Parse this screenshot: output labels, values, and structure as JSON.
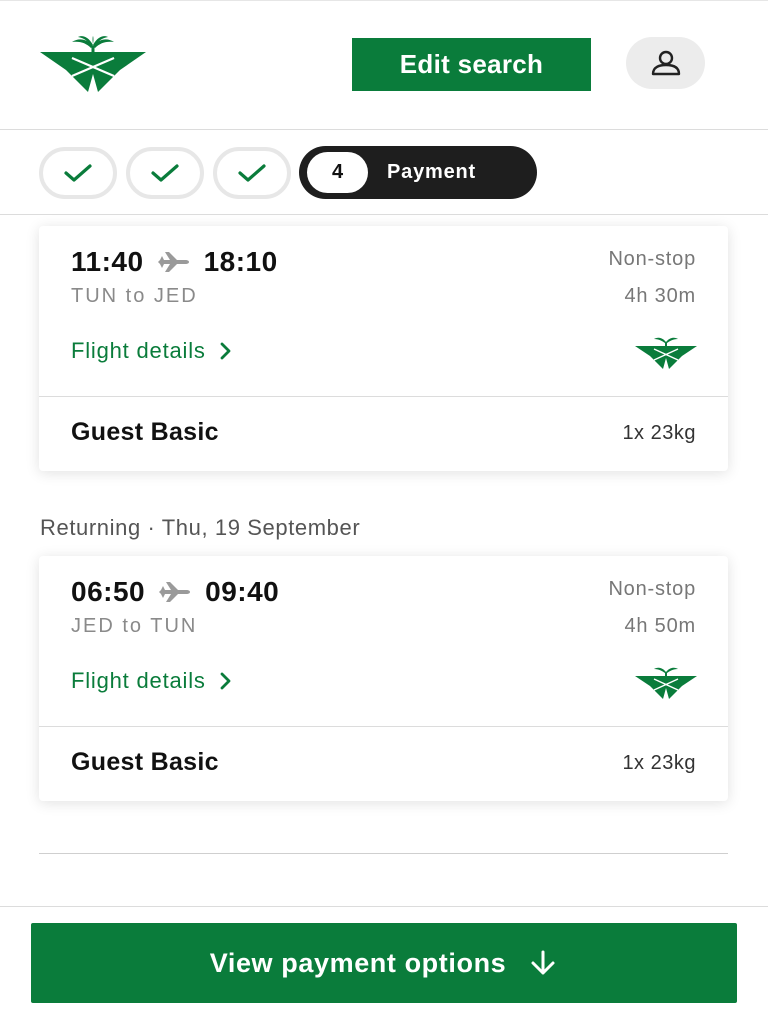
{
  "header": {
    "logo_icon": "saudia-palm-logo-icon",
    "edit_search_label": "Edit search",
    "profile_icon": "user-icon"
  },
  "steps": {
    "completed_count": 3,
    "current_number": "4",
    "current_label": "Payment"
  },
  "flights": [
    {
      "depart_time": "11:40",
      "arrive_time": "18:10",
      "route_from": "TUN",
      "route_sep": "to",
      "route_to": "JED",
      "stops": "Non-stop",
      "duration": "4h 30m",
      "details_label": "Flight details",
      "fare": "Guest Basic",
      "baggage": "1x 23kg"
    },
    {
      "depart_time": "06:50",
      "arrive_time": "09:40",
      "route_from": "JED",
      "route_sep": "to",
      "route_to": "TUN",
      "stops": "Non-stop",
      "duration": "4h 50m",
      "details_label": "Flight details",
      "fare": "Guest Basic",
      "baggage": "1x 23kg"
    }
  ],
  "returning_label": "Returning · Thu, 19 September",
  "payment_button_label": "View payment options",
  "colors": {
    "brand_green": "#0a7c3b",
    "dark_pill": "#1e1e1e"
  }
}
